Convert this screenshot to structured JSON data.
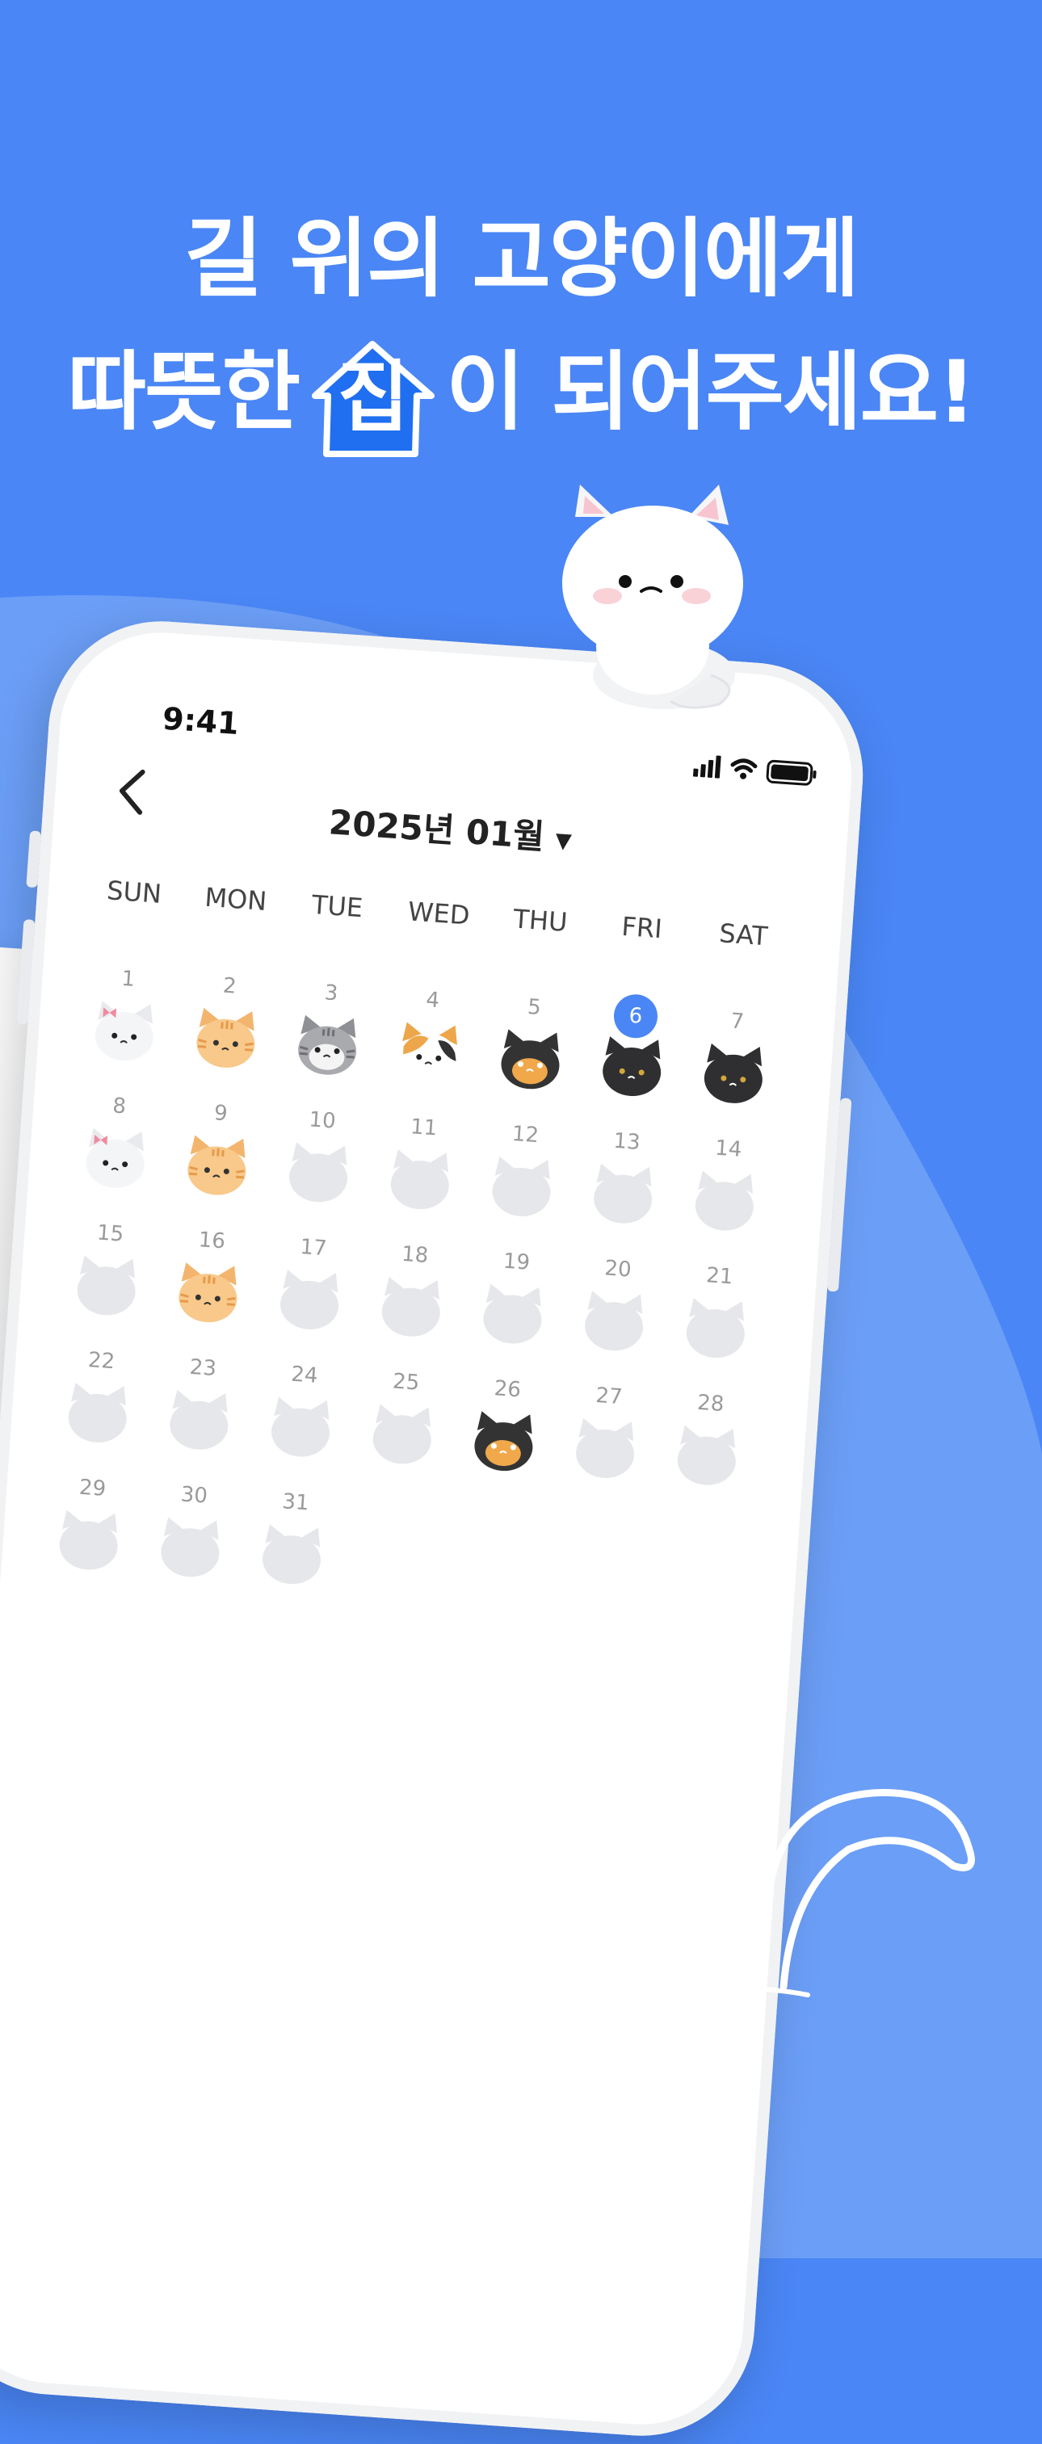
{
  "headline": {
    "line1": "길 위의 고양이에게",
    "line2_before": "따뜻한",
    "line2_highlight": "집",
    "line2_after": "이 되어주세요!"
  },
  "status_bar": {
    "time": "9:41"
  },
  "calendar": {
    "title": "2025년 01월",
    "weekdays": [
      "SUN",
      "MON",
      "TUE",
      "WED",
      "THU",
      "FRI",
      "SAT"
    ],
    "today": 6,
    "days": [
      {
        "d": "1",
        "cat": "white-bow"
      },
      {
        "d": "2",
        "cat": "orange"
      },
      {
        "d": "3",
        "cat": "gray-tabby"
      },
      {
        "d": "4",
        "cat": "calico-white"
      },
      {
        "d": "5",
        "cat": "calico-dark"
      },
      {
        "d": "6",
        "cat": "black"
      },
      {
        "d": "7",
        "cat": "black"
      },
      {
        "d": "8",
        "cat": "white-bow"
      },
      {
        "d": "9",
        "cat": "orange"
      },
      {
        "d": "10",
        "cat": "empty"
      },
      {
        "d": "11",
        "cat": "empty"
      },
      {
        "d": "12",
        "cat": "empty"
      },
      {
        "d": "13",
        "cat": "empty"
      },
      {
        "d": "14",
        "cat": "empty"
      },
      {
        "d": "15",
        "cat": "empty"
      },
      {
        "d": "16",
        "cat": "orange"
      },
      {
        "d": "17",
        "cat": "empty"
      },
      {
        "d": "18",
        "cat": "empty"
      },
      {
        "d": "19",
        "cat": "empty"
      },
      {
        "d": "20",
        "cat": "empty"
      },
      {
        "d": "21",
        "cat": "empty"
      },
      {
        "d": "22",
        "cat": "empty"
      },
      {
        "d": "23",
        "cat": "empty"
      },
      {
        "d": "24",
        "cat": "empty"
      },
      {
        "d": "25",
        "cat": "empty"
      },
      {
        "d": "26",
        "cat": "calico-dark"
      },
      {
        "d": "27",
        "cat": "empty"
      },
      {
        "d": "28",
        "cat": "empty"
      },
      {
        "d": "29",
        "cat": "empty"
      },
      {
        "d": "30",
        "cat": "empty"
      },
      {
        "d": "31",
        "cat": "empty"
      }
    ]
  },
  "colors": {
    "background": "#4a86f5",
    "accent": "#4a86f5",
    "house": "#1f6ff0",
    "empty_cat": "#e6e7ea"
  }
}
